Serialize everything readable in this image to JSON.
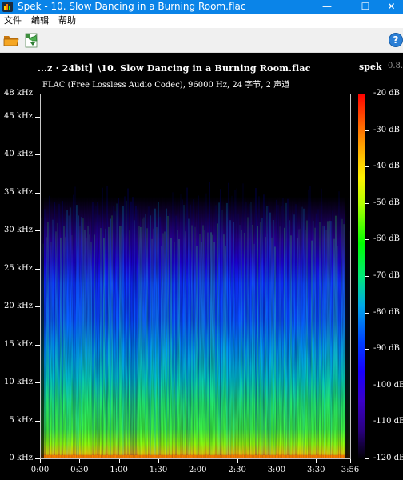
{
  "window": {
    "title": "Spek - 10. Slow Dancing in a Burning Room.flac",
    "minimize": "—",
    "maximize": "☐",
    "close": "✕"
  },
  "menu": {
    "file": "文件",
    "edit": "编辑",
    "help": "帮助"
  },
  "toolbar": {
    "open_icon": "folder-open-icon",
    "save_icon": "save-image-icon",
    "help_icon": "help-icon",
    "help_glyph": "?"
  },
  "header": {
    "file_path": "...z  ·  24bit】\\10. Slow Dancing in a Burning Room.flac",
    "app_name": "spek",
    "app_version": "0.8.",
    "audio_info": "FLAC (Free Lossless Audio Codec), 96000 Hz, 24 字节, 2 声道"
  },
  "colors": {
    "titlebar": "#0a84e8",
    "background": "#000000",
    "frame": "#c8c8c8"
  },
  "chart_data": {
    "type": "heatmap",
    "y_ticks": [
      "48 kHz",
      "45 kHz",
      "40 kHz",
      "35 kHz",
      "30 kHz",
      "25 kHz",
      "20 kHz",
      "15 kHz",
      "10 kHz",
      "5 kHz",
      "0 kHz"
    ],
    "y_values_khz": [
      48,
      45,
      40,
      35,
      30,
      25,
      20,
      15,
      10,
      5,
      0
    ],
    "x_ticks": [
      "0:00",
      "0:30",
      "1:00",
      "1:30",
      "2:00",
      "2:30",
      "3:00",
      "3:30",
      "3:56"
    ],
    "x_values_sec": [
      0,
      30,
      60,
      90,
      120,
      150,
      180,
      210,
      236
    ],
    "duration_sec": 236,
    "max_freq_khz": 48,
    "legend_ticks": [
      "-20 dB",
      "-30 dB",
      "-40 dB",
      "-50 dB",
      "-60 dB",
      "-70 dB",
      "-80 dB",
      "-90 dB",
      "-100 dB",
      "-110 dB",
      "-120 dB"
    ],
    "legend_values_db": [
      -20,
      -30,
      -40,
      -50,
      -60,
      -70,
      -80,
      -90,
      -100,
      -110,
      -120
    ],
    "energy_bands_khz": [
      {
        "from": 0,
        "to": 0.4,
        "level_db": -25
      },
      {
        "from": 0.4,
        "to": 3,
        "level_db": -55
      },
      {
        "from": 3,
        "to": 13,
        "level_db": -80
      },
      {
        "from": 13,
        "to": 26,
        "level_db": -95
      },
      {
        "from": 26,
        "to": 33,
        "level_db": -108
      }
    ]
  }
}
